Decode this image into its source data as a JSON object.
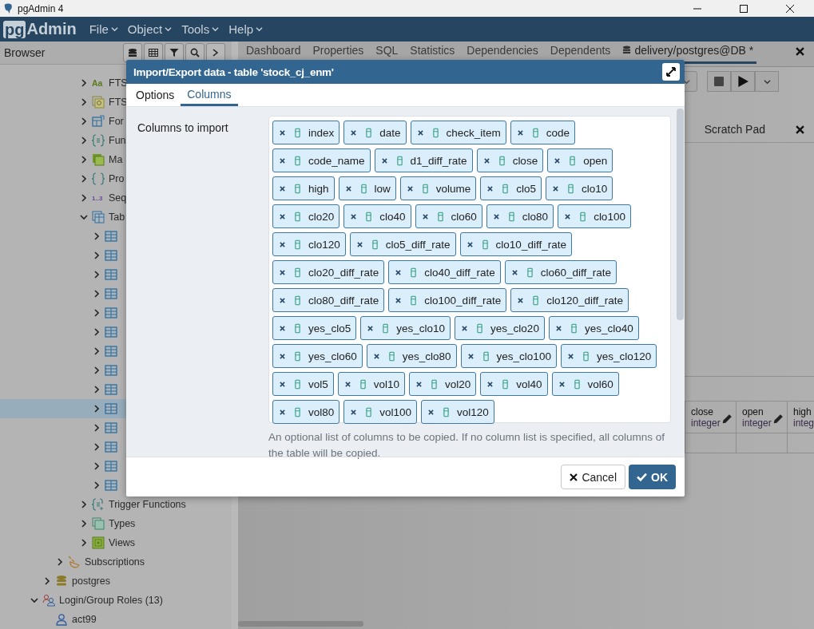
{
  "window": {
    "title": "pgAdmin 4"
  },
  "menu": {
    "logo_prefix": "pg",
    "logo_suffix": "Admin",
    "items": [
      "File",
      "Object",
      "Tools",
      "Help"
    ]
  },
  "browser": {
    "title": "Browser",
    "schema_objects": [
      {
        "label": "FTS",
        "kind": "fts-parser",
        "glyph": "Aa",
        "expanded": false,
        "selected": false
      },
      {
        "label": "FTS",
        "kind": "fts-template",
        "expanded": false,
        "selected": false
      },
      {
        "label": "For",
        "kind": "foreign-table",
        "expanded": false,
        "selected": false
      },
      {
        "label": "Fun",
        "kind": "function",
        "expanded": false,
        "selected": false
      },
      {
        "label": "Ma",
        "kind": "mview",
        "expanded": false,
        "selected": false
      },
      {
        "label": "Pro",
        "kind": "procedure",
        "expanded": false,
        "selected": false
      },
      {
        "label": "Seq",
        "kind": "sequence",
        "glyph": "1..3",
        "expanded": false,
        "selected": false
      },
      {
        "label": "Tab",
        "kind": "table-group",
        "expanded": true,
        "selected": false,
        "children": [
          {
            "kind": "table",
            "expanded": false,
            "selected": false
          },
          {
            "kind": "table",
            "expanded": false,
            "selected": false
          },
          {
            "kind": "table",
            "expanded": false,
            "selected": false
          },
          {
            "kind": "table",
            "expanded": false,
            "selected": false
          },
          {
            "kind": "table",
            "expanded": false,
            "selected": false
          },
          {
            "kind": "table",
            "expanded": false,
            "selected": false
          },
          {
            "kind": "table",
            "expanded": false,
            "selected": false
          },
          {
            "kind": "table",
            "expanded": false,
            "selected": false
          },
          {
            "kind": "table",
            "expanded": false,
            "selected": false
          },
          {
            "kind": "table",
            "expanded": false,
            "selected": true
          },
          {
            "kind": "table",
            "expanded": false,
            "selected": false
          },
          {
            "kind": "table",
            "expanded": false,
            "selected": false
          },
          {
            "kind": "table",
            "expanded": false,
            "selected": false
          },
          {
            "kind": "table",
            "expanded": false,
            "selected": false
          }
        ]
      },
      {
        "label": "Trigger Functions",
        "kind": "trigger-function",
        "expanded": false,
        "selected": false
      },
      {
        "label": "Types",
        "kind": "type",
        "expanded": false,
        "selected": false
      },
      {
        "label": "Views",
        "kind": "view",
        "expanded": false,
        "selected": false
      }
    ],
    "database_objects": [
      {
        "label": "Subscriptions",
        "kind": "subscription",
        "expanded": false,
        "selected": false
      }
    ],
    "databases": [
      {
        "label": "postgres",
        "kind": "database",
        "expanded": false,
        "selected": false
      }
    ],
    "server_objects": [
      {
        "label": "Login/Group Roles (13)",
        "kind": "roles",
        "expanded": true,
        "selected": false,
        "children": [
          {
            "label": "act99",
            "kind": "role",
            "selected": false
          }
        ]
      }
    ]
  },
  "tabs": [
    {
      "label": "Dashboard",
      "kind": "page",
      "selected": false
    },
    {
      "label": "Properties",
      "kind": "page",
      "selected": false
    },
    {
      "label": "SQL",
      "kind": "page",
      "selected": false
    },
    {
      "label": "Statistics",
      "kind": "page",
      "selected": false
    },
    {
      "label": "Dependencies",
      "kind": "page",
      "selected": false
    },
    {
      "label": "Dependents",
      "kind": "page",
      "selected": false
    },
    {
      "label": "delivery/postgres@DB *",
      "kind": "connection",
      "selected": true
    }
  ],
  "scratch_pad": {
    "title": "Scratch Pad"
  },
  "grid_columns": [
    {
      "name": "close",
      "type": "integer",
      "editable": true
    },
    {
      "name": "open",
      "type": "integer",
      "editable": true
    },
    {
      "name": "high",
      "type": "integ"
    }
  ],
  "dialog": {
    "title": "Import/Export data - table 'stock_cj_enm'",
    "tabs": [
      {
        "label": "Options",
        "selected": false
      },
      {
        "label": "Columns",
        "selected": true
      }
    ],
    "field_label": "Columns to import",
    "columns": [
      "index",
      "date",
      "check_item",
      "code",
      "code_name",
      "d1_diff_rate",
      "close",
      "open",
      "high",
      "low",
      "volume",
      "clo5",
      "clo10",
      "clo20",
      "clo40",
      "clo60",
      "clo80",
      "clo100",
      "clo120",
      "clo5_diff_rate",
      "clo10_diff_rate",
      "clo20_diff_rate",
      "clo40_diff_rate",
      "clo60_diff_rate",
      "clo80_diff_rate",
      "clo100_diff_rate",
      "clo120_diff_rate",
      "yes_clo5",
      "yes_clo10",
      "yes_clo20",
      "yes_clo40",
      "yes_clo60",
      "yes_clo80",
      "yes_clo100",
      "yes_clo120",
      "vol5",
      "vol10",
      "vol20",
      "vol40",
      "vol60",
      "vol80",
      "vol100",
      "vol120"
    ],
    "help": "An optional list of columns to be copied. If no column list is specified, all columns of the table will be copied.",
    "buttons": [
      {
        "label": "Cancel",
        "kind": "cancel"
      },
      {
        "label": "OK",
        "kind": "ok"
      }
    ]
  }
}
